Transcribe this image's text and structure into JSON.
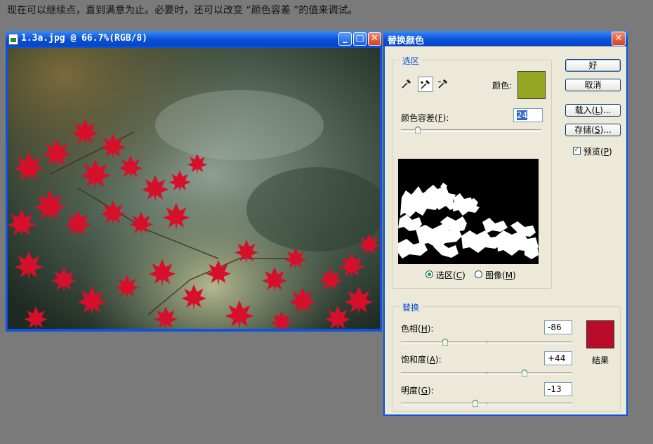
{
  "caption": "现在可以继续点，直到满意为止。必要时，还可以改变 “颜色容差 ”的值来调试。",
  "image_window": {
    "title": "1.3a.jpg @ 66.7%(RGB/8)",
    "minimize_glyph": "_",
    "maximize_glyph": "□",
    "close_glyph": "✕"
  },
  "dialog": {
    "title": "替换颜色",
    "close_glyph": "✕",
    "selection": {
      "legend": "选区",
      "color_label": "颜色:",
      "color_swatch": "#94a622",
      "tolerance_label": "颜色容差(F):",
      "tolerance_value": "24",
      "tolerance_fraction": 0.12,
      "radio_selection": "选区(C)",
      "radio_image": "图像(M)",
      "selected_mode": "selection"
    },
    "replace": {
      "legend": "替换",
      "hue_label": "色相(H):",
      "hue_value": "-86",
      "hue_fraction": 0.26,
      "saturation_label": "饱和度(A):",
      "saturation_value": "+44",
      "saturation_fraction": 0.72,
      "lightness_label": "明度(G):",
      "lightness_value": "-13",
      "lightness_fraction": 0.435,
      "result_label": "结果",
      "result_swatch": "#b80c2a"
    },
    "buttons": {
      "ok": "好",
      "cancel": "取消",
      "load": "载入(L)...",
      "save": "存储(S)..."
    },
    "preview_label": "预览(P)",
    "preview_checked": true
  },
  "icons": [
    "eyedropper-icon",
    "eyedropper-plus-icon",
    "eyedropper-minus-icon",
    "image-file-icon"
  ]
}
